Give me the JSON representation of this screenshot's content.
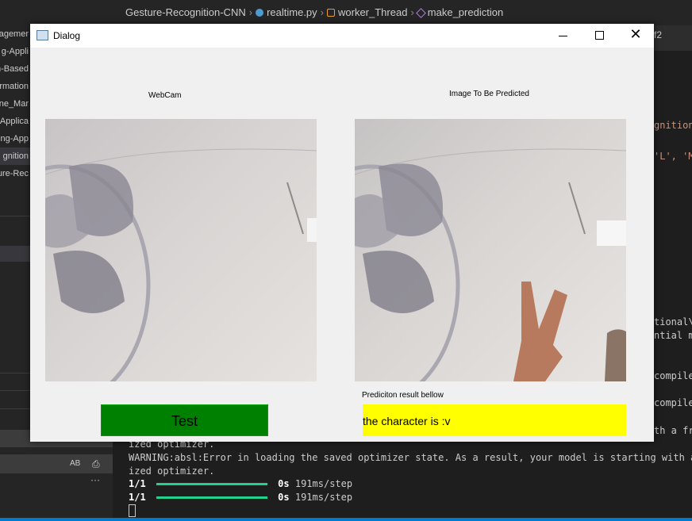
{
  "editor": {
    "breadcrumb": [
      "Gesture-Recognition-CNN",
      "realtime.py",
      "worker_Thread",
      "make_prediction"
    ],
    "tab_right": "f2"
  },
  "sidebar": {
    "items": [
      "agemer",
      "g-Appli",
      "n-Based",
      "rmation",
      "ne_Mar",
      "Applica",
      "ng-App",
      "gnition",
      "ure-Rec"
    ]
  },
  "left_panel": {
    "ab_label": "AB",
    "more": "···"
  },
  "code": {
    "line1": "gnition",
    "line2": "'L', 'M"
  },
  "terminal": {
    "right_lines": [
      "tional\\",
      "ntial mo",
      "compile_",
      "compile_",
      "th a fr"
    ],
    "lines": [
      "ized optimizer.",
      "WARNING:absl:Error in loading the saved optimizer state. As a result, your model is starting with a fr",
      "ized optimizer."
    ],
    "steps": [
      {
        "count": "1/1",
        "time": "0s",
        "rate": "191ms/step"
      },
      {
        "count": "1/1",
        "time": "0s",
        "rate": "191ms/step"
      }
    ]
  },
  "dialog": {
    "title": "Dialog",
    "webcam_label": "WebCam",
    "predict_label": "Image To Be Predicted",
    "result_caption": "Prediciton result bellow",
    "test_button": "Test",
    "result_text": "the character is :v",
    "colors": {
      "test_button": "#008000",
      "result_bg": "#ffff00"
    }
  }
}
